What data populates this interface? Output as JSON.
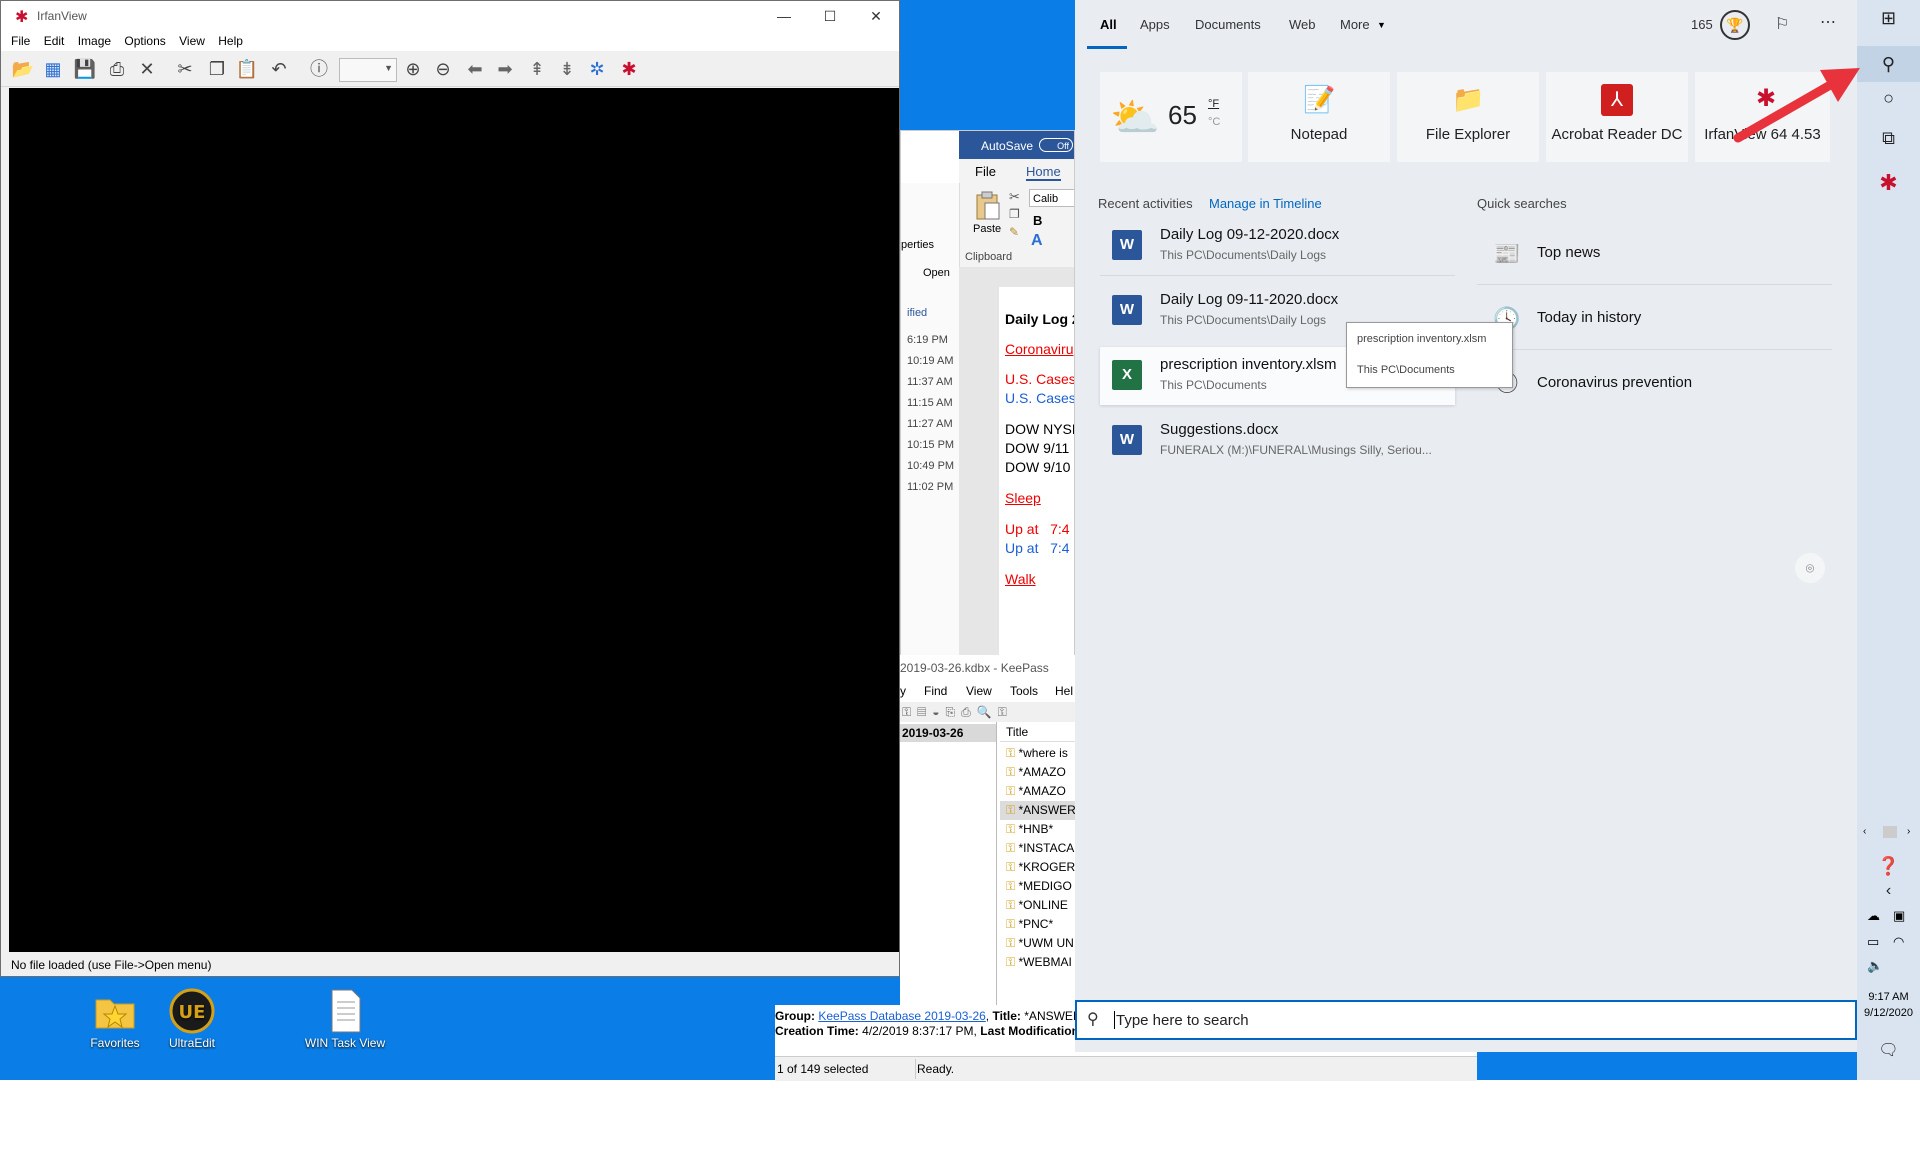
{
  "irfanview": {
    "title": "IrfanView",
    "menu": [
      "File",
      "Edit",
      "Image",
      "Options",
      "View",
      "Help"
    ],
    "status": "No file loaded (use File->Open menu)"
  },
  "desktop_icons": [
    "Favorites",
    "UltraEdit",
    "WIN Task View"
  ],
  "word": {
    "autosave": "AutoSave",
    "autosave_state": "Off",
    "tabs": [
      "File",
      "Home"
    ],
    "font": "Calib",
    "paste": "Paste",
    "clipboard": "Clipboard",
    "left_panel": {
      "properties": "perties",
      "open": "Open",
      "modified": "ified",
      "times": [
        "6:19 PM",
        "10:19 AM",
        "11:37 AM",
        "11:15 AM",
        "11:27 AM",
        "10:15 PM",
        "10:49 PM",
        "11:02 PM"
      ]
    },
    "doc_lines": [
      {
        "text": "Daily Log 2",
        "style": "bold"
      },
      {
        "text": "Coronaviru",
        "style": "red-underline"
      },
      {
        "text": "U.S. Cases",
        "style": "red"
      },
      {
        "text": "U.S. Cases",
        "style": "blue"
      },
      {
        "text": "DOW NYSE",
        "style": "normal"
      },
      {
        "text": "DOW 9/11",
        "style": "normal"
      },
      {
        "text": "DOW 9/10",
        "style": "normal"
      },
      {
        "text": "Sleep",
        "style": "red-underline"
      },
      {
        "text": "Up at   7:4",
        "style": "red"
      },
      {
        "text": "Up at   7:4",
        "style": "blue"
      },
      {
        "text": "Walk",
        "style": "red-underline"
      }
    ]
  },
  "keepass": {
    "title": "2019-03-26.kdbx - KeePass",
    "menu": [
      "y",
      "Find",
      "View",
      "Tools",
      "Hel"
    ],
    "group": "2019-03-26",
    "col_title": "Title",
    "entries": [
      "*where is",
      "*AMAZO",
      "*AMAZO",
      "*ANSWER",
      "*HNB*",
      "*INSTACA",
      "*KROGER",
      "*MEDIGO",
      "*ONLINE",
      "*PNC*",
      "*UWM UN",
      "*WEBMAI"
    ],
    "info_group_label": "Group:",
    "info_group_value": "KeePass Database 2019-03-26",
    "info_title_label": "Title:",
    "info_title_value": "*ANSWERS N",
    "info_created_label": "Creation Time:",
    "info_created_value": "4/2/2019 8:37:17 PM,",
    "info_lastmod_label": "Last Modification",
    "selected": "1 of 149 selected",
    "ready": "Ready."
  },
  "search": {
    "tabs": [
      "All",
      "Apps",
      "Documents",
      "Web",
      "More"
    ],
    "points": "165",
    "weather_temp": "65",
    "weather_unit_f": "°F",
    "weather_unit_c": "°C",
    "tiles": [
      "Notepad",
      "File Explorer",
      "Acrobat Reader DC",
      "IrfanView 64 4.53"
    ],
    "recent_label": "Recent activities",
    "manage_link": "Manage in Timeline",
    "quick_label": "Quick searches",
    "activities": [
      {
        "title": "Daily Log 09-12-2020.docx",
        "path": "This PC\\Documents\\Daily Logs",
        "app": "word"
      },
      {
        "title": "Daily Log 09-11-2020.docx",
        "path": "This PC\\Documents\\Daily Logs",
        "app": "word"
      },
      {
        "title": "prescription inventory.xlsm",
        "path": "This PC\\Documents",
        "app": "excel"
      },
      {
        "title": "Suggestions.docx",
        "path": "FUNERALX (M:)\\FUNERAL\\Musings Silly, Seriou...",
        "app": "word"
      }
    ],
    "quick_searches": [
      "Top news",
      "Today in history",
      "Coronavirus prevention"
    ],
    "tooltip_name": "prescription inventory.xlsm",
    "tooltip_path": "This PC\\Documents",
    "placeholder": "Type here to search"
  },
  "taskbar": {
    "time": "9:17 AM",
    "date": "9/12/2020"
  },
  "colors": {
    "desktop": "#0a7ee6",
    "accent": "#0067c0",
    "word_blue": "#2b579a",
    "excel_green": "#217346",
    "arrow": "#e8323c"
  }
}
